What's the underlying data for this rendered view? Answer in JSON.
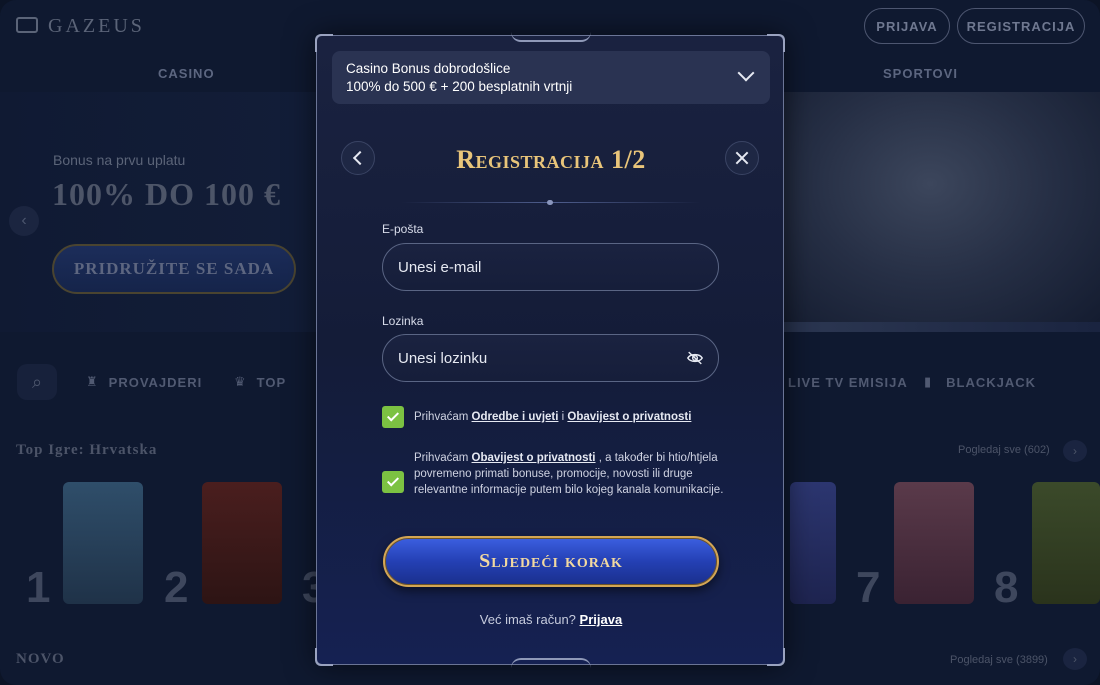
{
  "background": {
    "logo": "GAZEUS",
    "login": "PRIJAVA",
    "register": "REGISTRACIJA",
    "nav_casino": "CASINO",
    "nav_sport": "SPORTOVI",
    "bonus_small": "Bonus na prvu uplatu",
    "bonus_large": "100% DO 100 €",
    "join": "PRIDRUŽITE SE SADA",
    "categories": [
      "PROVAJDERI",
      "TOP",
      "LIVE TV EMISIJA",
      "BLACKJACK"
    ],
    "section_top": "Top Igre: Hrvatska",
    "see_all_top": "Pogledaj sve (602)",
    "ranks": [
      "1",
      "2",
      "3",
      "7",
      "8"
    ],
    "section_new": "NOVO",
    "see_all_new": "Pogledaj sve (3899)"
  },
  "modal": {
    "bonus_title": "Casino Bonus dobrodošlice",
    "bonus_subtitle": "100% do 500 € + 200 besplatnih vrtnji",
    "title": "Registracija 1/2",
    "email_label": "E-pošta",
    "email_placeholder": "Unesi e-mail",
    "password_label": "Lozinka",
    "password_placeholder": "Unesi lozinku",
    "consent1_prefix": "Prihvaćam",
    "consent1_link1": "Odredbe i uvjeti",
    "consent1_and": "i",
    "consent1_link2": "Obavijest o privatnosti",
    "consent2_prefix": "Prihvaćam",
    "consent2_link": "Obavijest o privatnosti",
    "consent2_text": ", a također bi htio/htjela povremeno primati bonuse, promocije, novosti ili druge relevantne informacije putem bilo kojeg kanala komunikacije.",
    "next_button": "Sljedeći korak",
    "already_text": "Već imaš račun?",
    "login_link": "Prijava"
  },
  "colors": {
    "accent_gold": "#e9c57a",
    "checkbox_green": "#7cc242",
    "button_blue": "#2440b4"
  }
}
